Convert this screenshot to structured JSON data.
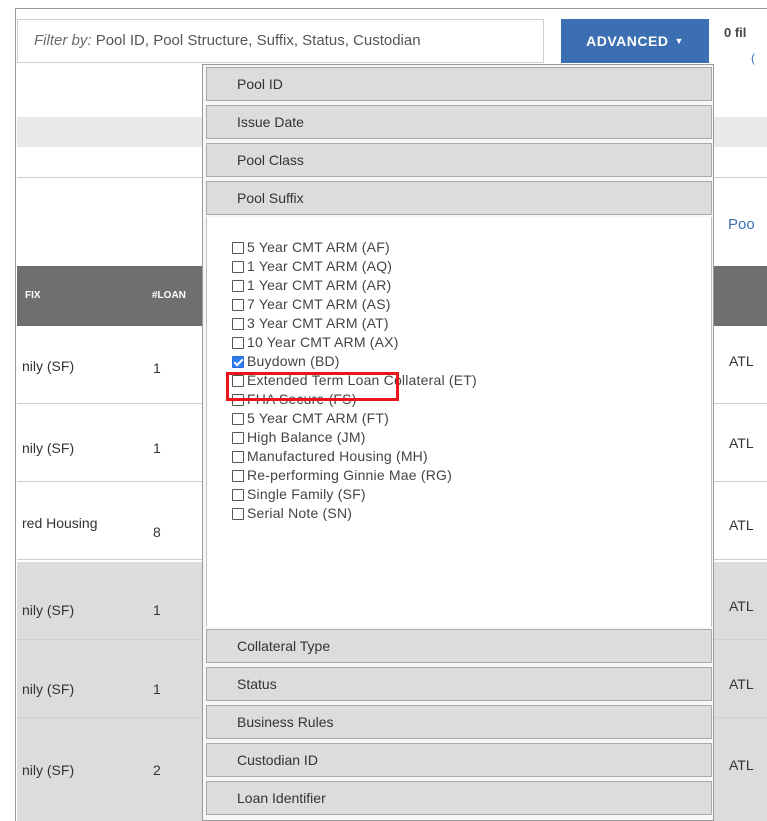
{
  "filter": {
    "prefix": "Filter by:",
    "placeholder": "Pool ID, Pool Structure, Suffix, Status, Custodian"
  },
  "advanced_button": {
    "label": "ADVANCED",
    "caret": "▼"
  },
  "filters_count": "0 fil",
  "filters_sub": "(",
  "select_chevron": "⌄",
  "pool_link": "Poo",
  "table": {
    "headers": {
      "suffix": "FIX",
      "loans": "#LOAN"
    },
    "rows": [
      {
        "suffix": "nily (SF)",
        "loans": "1",
        "agency": "ATL"
      },
      {
        "suffix": "nily (SF)",
        "loans": "1",
        "agency": "ATL"
      },
      {
        "suffix": "red Housing",
        "loans": "8",
        "agency": "ATL"
      },
      {
        "suffix": "nily (SF)",
        "loans": "1",
        "agency": "ATL"
      },
      {
        "suffix": "nily (SF)",
        "loans": "1",
        "agency": "ATL"
      },
      {
        "suffix": "nily (SF)",
        "loans": "2",
        "agency": "ATL"
      }
    ]
  },
  "dropdown": {
    "sections_top": [
      "Pool ID",
      "Issue Date",
      "Pool Class",
      "Pool Suffix"
    ],
    "suffix_options": [
      {
        "label": "5 Year CMT ARM (AF)",
        "checked": false
      },
      {
        "label": "1 Year CMT ARM (AQ)",
        "checked": false
      },
      {
        "label": "1 Year CMT ARM (AR)",
        "checked": false
      },
      {
        "label": "7 Year CMT ARM (AS)",
        "checked": false
      },
      {
        "label": "3 Year CMT ARM (AT)",
        "checked": false
      },
      {
        "label": "10 Year CMT ARM (AX)",
        "checked": false
      },
      {
        "label": "Buydown (BD)",
        "checked": true
      },
      {
        "label": "Extended Term Loan Collateral (ET)",
        "checked": false
      },
      {
        "label": "FHA Secure (FS)",
        "checked": false
      },
      {
        "label": "5 Year CMT ARM (FT)",
        "checked": false
      },
      {
        "label": "High Balance (JM)",
        "checked": false
      },
      {
        "label": "Manufactured Housing (MH)",
        "checked": false
      },
      {
        "label": "Re-performing Ginnie Mae (RG)",
        "checked": false
      },
      {
        "label": "Single Family (SF)",
        "checked": false
      },
      {
        "label": "Serial Note (SN)",
        "checked": false
      }
    ],
    "sections_bottom": [
      "Collateral Type",
      "Status",
      "Business Rules",
      "Custodian ID",
      "Loan Identifier"
    ]
  },
  "colors": {
    "accent": "#3b6fb1",
    "highlight": "#e8161b",
    "header_bg": "#6f6f6f"
  }
}
